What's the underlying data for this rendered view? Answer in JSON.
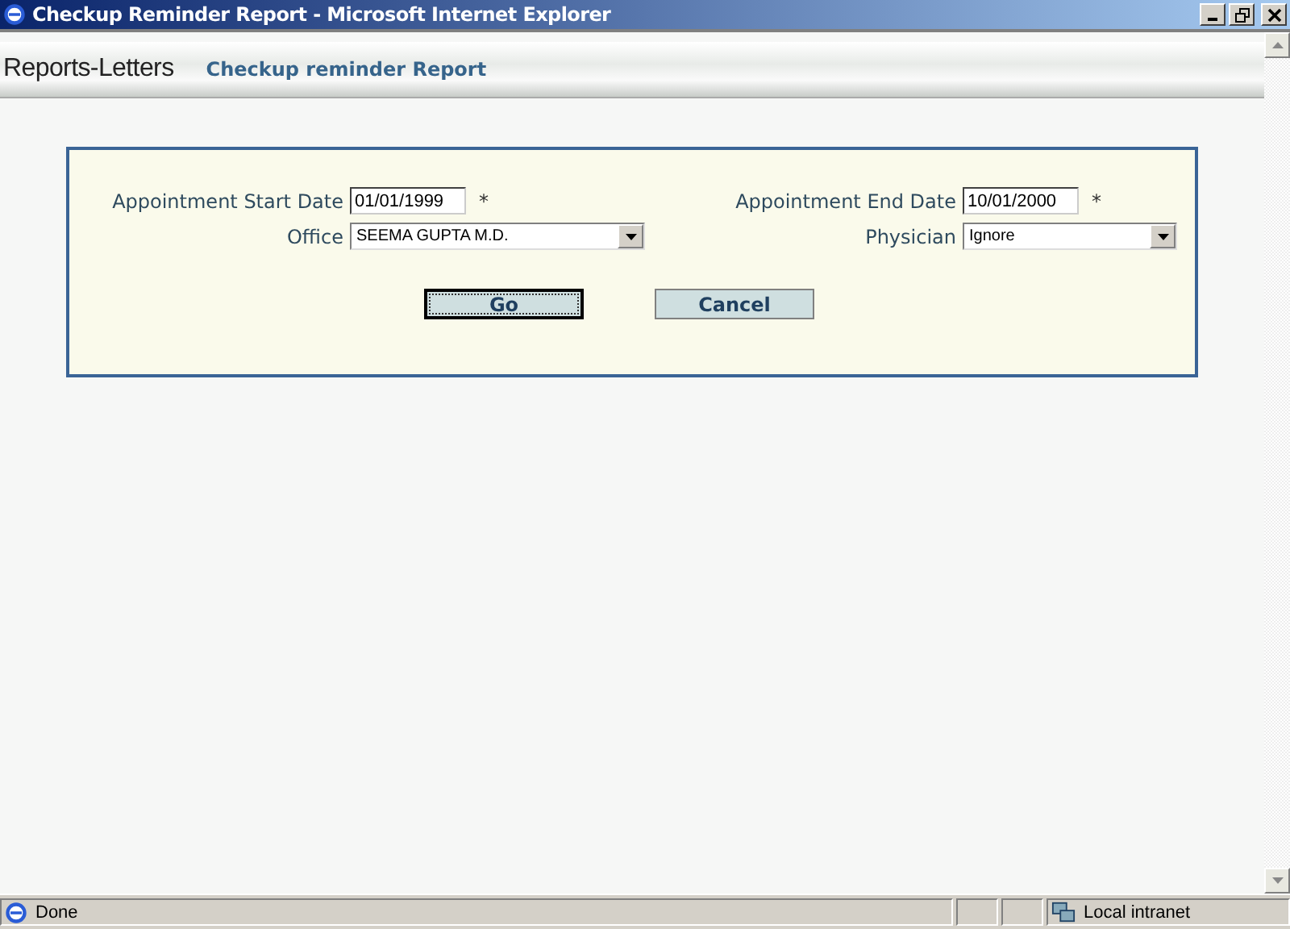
{
  "window": {
    "title": "Checkup Reminder Report - Microsoft Internet Explorer"
  },
  "header": {
    "section": "Reports-Letters",
    "page_title": "Checkup reminder Report"
  },
  "form": {
    "fields": [
      {
        "label": "Appointment Start Date",
        "kind": "text",
        "value": "01/01/1999",
        "required": true
      },
      {
        "label": "Appointment End Date",
        "kind": "text",
        "value": "10/01/2000",
        "required": true
      },
      {
        "label": "Office",
        "kind": "select",
        "value": "SEEMA GUPTA M.D.",
        "required": false
      },
      {
        "label": "Physician",
        "kind": "select",
        "value": "Ignore",
        "required": false
      }
    ],
    "required_mark": "*",
    "buttons": [
      {
        "label": "Go",
        "focused": true
      },
      {
        "label": "Cancel",
        "focused": false
      }
    ]
  },
  "status_bar": {
    "text": "Done",
    "zone": "Local intranet"
  }
}
